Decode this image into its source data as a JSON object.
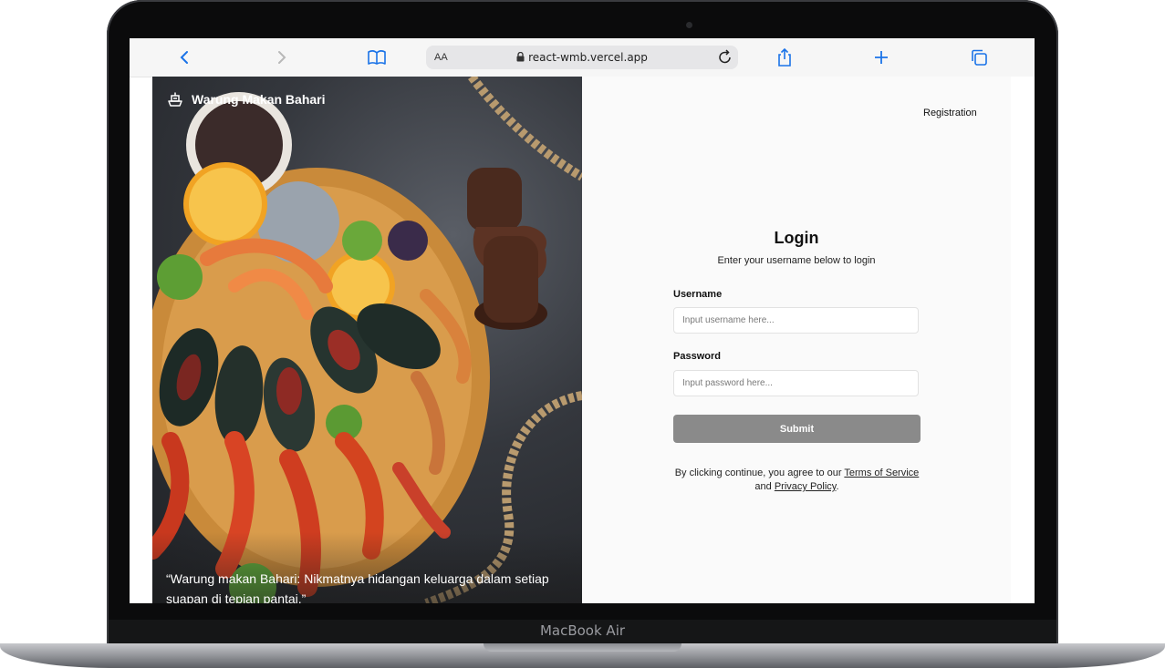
{
  "device": {
    "label": "MacBook Air"
  },
  "browser": {
    "text_size_label": "AA",
    "url": "react-wmb.vercel.app",
    "icons": [
      "chevron-left-icon",
      "chevron-right-icon",
      "book-icon",
      "lock-icon",
      "reload-icon",
      "share-icon",
      "plus-icon",
      "tabs-icon"
    ]
  },
  "hero": {
    "brand": "Warung Makan Bahari",
    "quote": "“Warung makan Bahari: Nikmatnya hidangan keluarga dalam setiap suapan di tepian pantai.”"
  },
  "header": {
    "registration_link": "Registration"
  },
  "login": {
    "title": "Login",
    "subtitle": "Enter your username below to login",
    "username_label": "Username",
    "username_placeholder": "Input username here...",
    "password_label": "Password",
    "password_placeholder": "Input password here...",
    "submit_label": "Submit",
    "terms_prefix": "By clicking continue, you agree to our ",
    "terms_link": "Terms of Service",
    "terms_and": " and ",
    "privacy_link": "Privacy Policy",
    "terms_suffix": "."
  },
  "colors": {
    "submit_bg": "#8a8a8a",
    "page_bg": "#fafafa",
    "accent_browser": "#1a73e8"
  }
}
